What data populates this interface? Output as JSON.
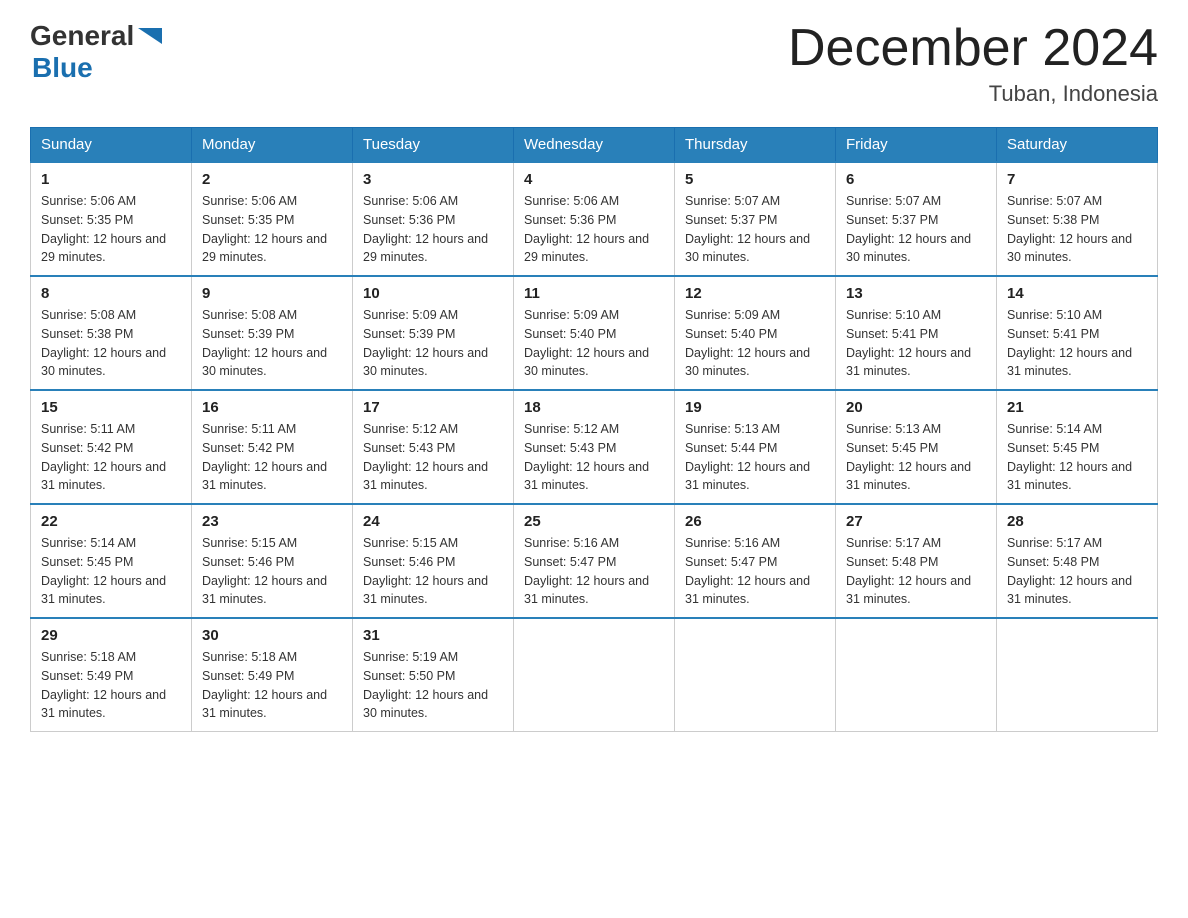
{
  "header": {
    "logo": {
      "text_general": "General",
      "arrow_color": "#1a6faf",
      "text_blue": "Blue"
    },
    "title": "December 2024",
    "location": "Tuban, Indonesia"
  },
  "days_of_week": [
    "Sunday",
    "Monday",
    "Tuesday",
    "Wednesday",
    "Thursday",
    "Friday",
    "Saturday"
  ],
  "weeks": [
    [
      {
        "day": "1",
        "sunrise": "5:06 AM",
        "sunset": "5:35 PM",
        "daylight": "12 hours and 29 minutes."
      },
      {
        "day": "2",
        "sunrise": "5:06 AM",
        "sunset": "5:35 PM",
        "daylight": "12 hours and 29 minutes."
      },
      {
        "day": "3",
        "sunrise": "5:06 AM",
        "sunset": "5:36 PM",
        "daylight": "12 hours and 29 minutes."
      },
      {
        "day": "4",
        "sunrise": "5:06 AM",
        "sunset": "5:36 PM",
        "daylight": "12 hours and 29 minutes."
      },
      {
        "day": "5",
        "sunrise": "5:07 AM",
        "sunset": "5:37 PM",
        "daylight": "12 hours and 30 minutes."
      },
      {
        "day": "6",
        "sunrise": "5:07 AM",
        "sunset": "5:37 PM",
        "daylight": "12 hours and 30 minutes."
      },
      {
        "day": "7",
        "sunrise": "5:07 AM",
        "sunset": "5:38 PM",
        "daylight": "12 hours and 30 minutes."
      }
    ],
    [
      {
        "day": "8",
        "sunrise": "5:08 AM",
        "sunset": "5:38 PM",
        "daylight": "12 hours and 30 minutes."
      },
      {
        "day": "9",
        "sunrise": "5:08 AM",
        "sunset": "5:39 PM",
        "daylight": "12 hours and 30 minutes."
      },
      {
        "day": "10",
        "sunrise": "5:09 AM",
        "sunset": "5:39 PM",
        "daylight": "12 hours and 30 minutes."
      },
      {
        "day": "11",
        "sunrise": "5:09 AM",
        "sunset": "5:40 PM",
        "daylight": "12 hours and 30 minutes."
      },
      {
        "day": "12",
        "sunrise": "5:09 AM",
        "sunset": "5:40 PM",
        "daylight": "12 hours and 30 minutes."
      },
      {
        "day": "13",
        "sunrise": "5:10 AM",
        "sunset": "5:41 PM",
        "daylight": "12 hours and 31 minutes."
      },
      {
        "day": "14",
        "sunrise": "5:10 AM",
        "sunset": "5:41 PM",
        "daylight": "12 hours and 31 minutes."
      }
    ],
    [
      {
        "day": "15",
        "sunrise": "5:11 AM",
        "sunset": "5:42 PM",
        "daylight": "12 hours and 31 minutes."
      },
      {
        "day": "16",
        "sunrise": "5:11 AM",
        "sunset": "5:42 PM",
        "daylight": "12 hours and 31 minutes."
      },
      {
        "day": "17",
        "sunrise": "5:12 AM",
        "sunset": "5:43 PM",
        "daylight": "12 hours and 31 minutes."
      },
      {
        "day": "18",
        "sunrise": "5:12 AM",
        "sunset": "5:43 PM",
        "daylight": "12 hours and 31 minutes."
      },
      {
        "day": "19",
        "sunrise": "5:13 AM",
        "sunset": "5:44 PM",
        "daylight": "12 hours and 31 minutes."
      },
      {
        "day": "20",
        "sunrise": "5:13 AM",
        "sunset": "5:45 PM",
        "daylight": "12 hours and 31 minutes."
      },
      {
        "day": "21",
        "sunrise": "5:14 AM",
        "sunset": "5:45 PM",
        "daylight": "12 hours and 31 minutes."
      }
    ],
    [
      {
        "day": "22",
        "sunrise": "5:14 AM",
        "sunset": "5:45 PM",
        "daylight": "12 hours and 31 minutes."
      },
      {
        "day": "23",
        "sunrise": "5:15 AM",
        "sunset": "5:46 PM",
        "daylight": "12 hours and 31 minutes."
      },
      {
        "day": "24",
        "sunrise": "5:15 AM",
        "sunset": "5:46 PM",
        "daylight": "12 hours and 31 minutes."
      },
      {
        "day": "25",
        "sunrise": "5:16 AM",
        "sunset": "5:47 PM",
        "daylight": "12 hours and 31 minutes."
      },
      {
        "day": "26",
        "sunrise": "5:16 AM",
        "sunset": "5:47 PM",
        "daylight": "12 hours and 31 minutes."
      },
      {
        "day": "27",
        "sunrise": "5:17 AM",
        "sunset": "5:48 PM",
        "daylight": "12 hours and 31 minutes."
      },
      {
        "day": "28",
        "sunrise": "5:17 AM",
        "sunset": "5:48 PM",
        "daylight": "12 hours and 31 minutes."
      }
    ],
    [
      {
        "day": "29",
        "sunrise": "5:18 AM",
        "sunset": "5:49 PM",
        "daylight": "12 hours and 31 minutes."
      },
      {
        "day": "30",
        "sunrise": "5:18 AM",
        "sunset": "5:49 PM",
        "daylight": "12 hours and 31 minutes."
      },
      {
        "day": "31",
        "sunrise": "5:19 AM",
        "sunset": "5:50 PM",
        "daylight": "12 hours and 30 minutes."
      },
      null,
      null,
      null,
      null
    ]
  ],
  "labels": {
    "sunrise": "Sunrise:",
    "sunset": "Sunset:",
    "daylight": "Daylight:"
  }
}
